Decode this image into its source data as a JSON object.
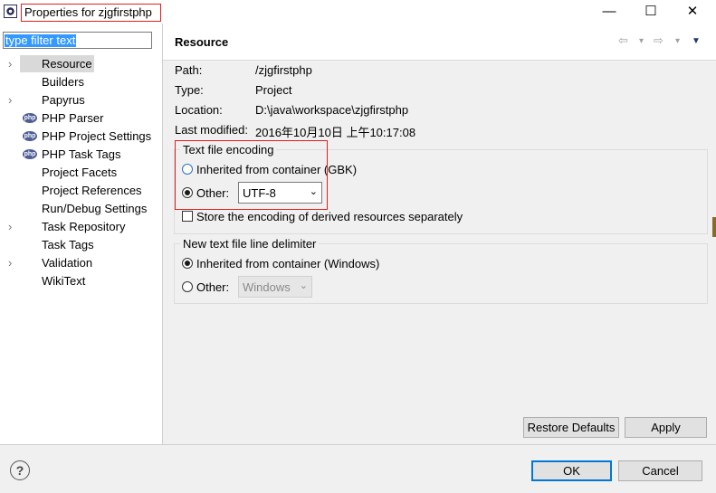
{
  "window": {
    "title": "Properties for zjgfirstphp",
    "minimize_glyph": "—",
    "maximize_glyph": "☐",
    "close_glyph": "✕"
  },
  "sidebar": {
    "filter_text": "type filter text",
    "items": [
      {
        "label": "Resource",
        "expandable": true,
        "icon": "none",
        "selected": true
      },
      {
        "label": "Builders",
        "expandable": false,
        "icon": "none"
      },
      {
        "label": "Papyrus",
        "expandable": true,
        "icon": "none"
      },
      {
        "label": "PHP Parser",
        "expandable": false,
        "icon": "php-icon",
        "icon_text": "php"
      },
      {
        "label": "PHP Project Settings",
        "expandable": false,
        "icon": "php-icon",
        "icon_text": "php"
      },
      {
        "label": "PHP Task Tags",
        "expandable": false,
        "icon": "php-icon",
        "icon_text": "php"
      },
      {
        "label": "Project Facets",
        "expandable": false,
        "icon": "none"
      },
      {
        "label": "Project References",
        "expandable": false,
        "icon": "none"
      },
      {
        "label": "Run/Debug Settings",
        "expandable": false,
        "icon": "none"
      },
      {
        "label": "Task Repository",
        "expandable": true,
        "icon": "none"
      },
      {
        "label": "Task Tags",
        "expandable": false,
        "icon": "none"
      },
      {
        "label": "Validation",
        "expandable": true,
        "icon": "none"
      },
      {
        "label": "WikiText",
        "expandable": false,
        "icon": "none"
      }
    ]
  },
  "page": {
    "heading": "Resource",
    "nav": {
      "back": "⇦",
      "forward": "⇨",
      "dropdown": "▾",
      "menu": "▼"
    },
    "info": {
      "path_label": "Path:",
      "path_value": "/zjgfirstphp",
      "type_label": "Type:",
      "type_value": "Project",
      "location_label": "Location:",
      "location_value": "D:\\java\\workspace\\zjgfirstphp",
      "modified_label": "Last modified:",
      "modified_value": "2016年10月10日 上午10:17:08"
    },
    "encoding": {
      "group_title": "Text file encoding",
      "inherited_label": "Inherited from container (GBK)",
      "other_label": "Other:",
      "other_value": "UTF-8",
      "selected": "other",
      "store_derived_label": "Store the encoding of derived resources separately",
      "store_derived_checked": false
    },
    "line_delimiter": {
      "group_title": "New text file line delimiter",
      "inherited_label": "Inherited from container (Windows)",
      "other_label": "Other:",
      "other_value": "Windows",
      "selected": "inherited"
    },
    "restore_defaults_label": "Restore Defaults",
    "apply_label": "Apply"
  },
  "footer": {
    "help_glyph": "?",
    "ok_label": "OK",
    "cancel_label": "Cancel"
  },
  "colors": {
    "highlight_box": "#e02020",
    "selection_blue": "#3399ff",
    "default_button_border": "#0078d7"
  }
}
